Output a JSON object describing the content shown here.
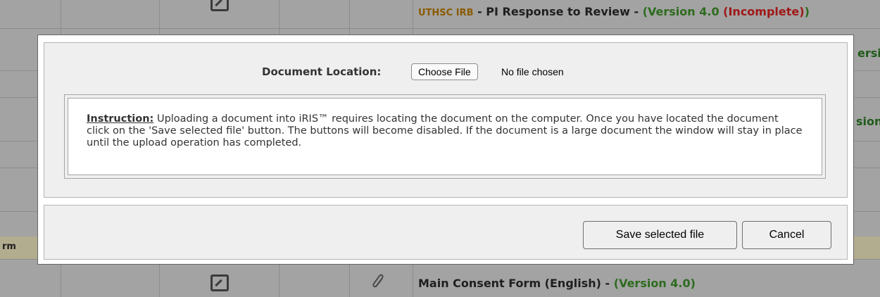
{
  "background": {
    "rows": [
      {
        "text_segments": [
          {
            "text": "UTHSC IRB",
            "color": "#8a5a00"
          },
          {
            "text": " - PI Response to Review - ",
            "color": "#1f1f1f"
          },
          {
            "text": "(Version 4.0",
            "color": "#2d6b1e"
          },
          {
            "text": " (Incomplete)",
            "color": "#a01818"
          },
          {
            "text": ")",
            "color": "#2d6b1e"
          }
        ]
      },
      {
        "right_fragment": "ersi"
      },
      {
        "right_fragment": "sion"
      },
      {
        "left_fragment": "rm"
      },
      {
        "text_segments": [
          {
            "text": "Main Consent Form (English)",
            "color": "#1f1f1f"
          },
          {
            "text": " - ",
            "color": "#1f1f1f"
          },
          {
            "text": "(Version 4.0)",
            "color": "#2d6b1e"
          }
        ]
      }
    ]
  },
  "modal": {
    "document_location_label": "Document Location:",
    "choose_file_button": "Choose File",
    "file_status": "No file chosen",
    "instruction": {
      "title": "Instruction:",
      "body": "Uploading a document into iRIS™ requires locating the document on the computer. Once you have located the document click on the 'Save selected file' button. The buttons will become disabled. If the document is a large document the window will stay in place until the upload operation has completed."
    },
    "save_button": "Save selected file",
    "cancel_button": "Cancel"
  },
  "icons": {
    "edit": "edit-document-icon",
    "attachment": "paperclip-icon"
  }
}
